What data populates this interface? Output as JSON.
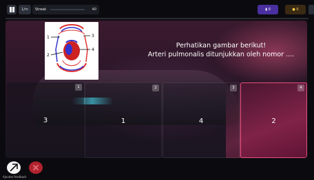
{
  "topbar": {
    "speed_label": "1/m",
    "streak_label": "Streak",
    "streak_points": "40"
  },
  "powerups_label": "0",
  "coins_label": "0",
  "question": {
    "line1": "Perhatikan gambar berikut!",
    "line2": "Arteri pulmonalis ditunjukkan oleh nomor ...."
  },
  "diagram_labels": [
    "1",
    "2",
    "3",
    "4"
  ],
  "options": [
    {
      "badge": "1",
      "text": "3"
    },
    {
      "badge": "2",
      "text": "1"
    },
    {
      "badge": "3",
      "text": "4"
    },
    {
      "badge": "4",
      "text": "2"
    }
  ],
  "footer_caption": "Ajoutez feedback",
  "colors": {
    "panel_accent": "#e7507e",
    "cancel": "#b0232e",
    "powerup": "#4a2fa0"
  }
}
